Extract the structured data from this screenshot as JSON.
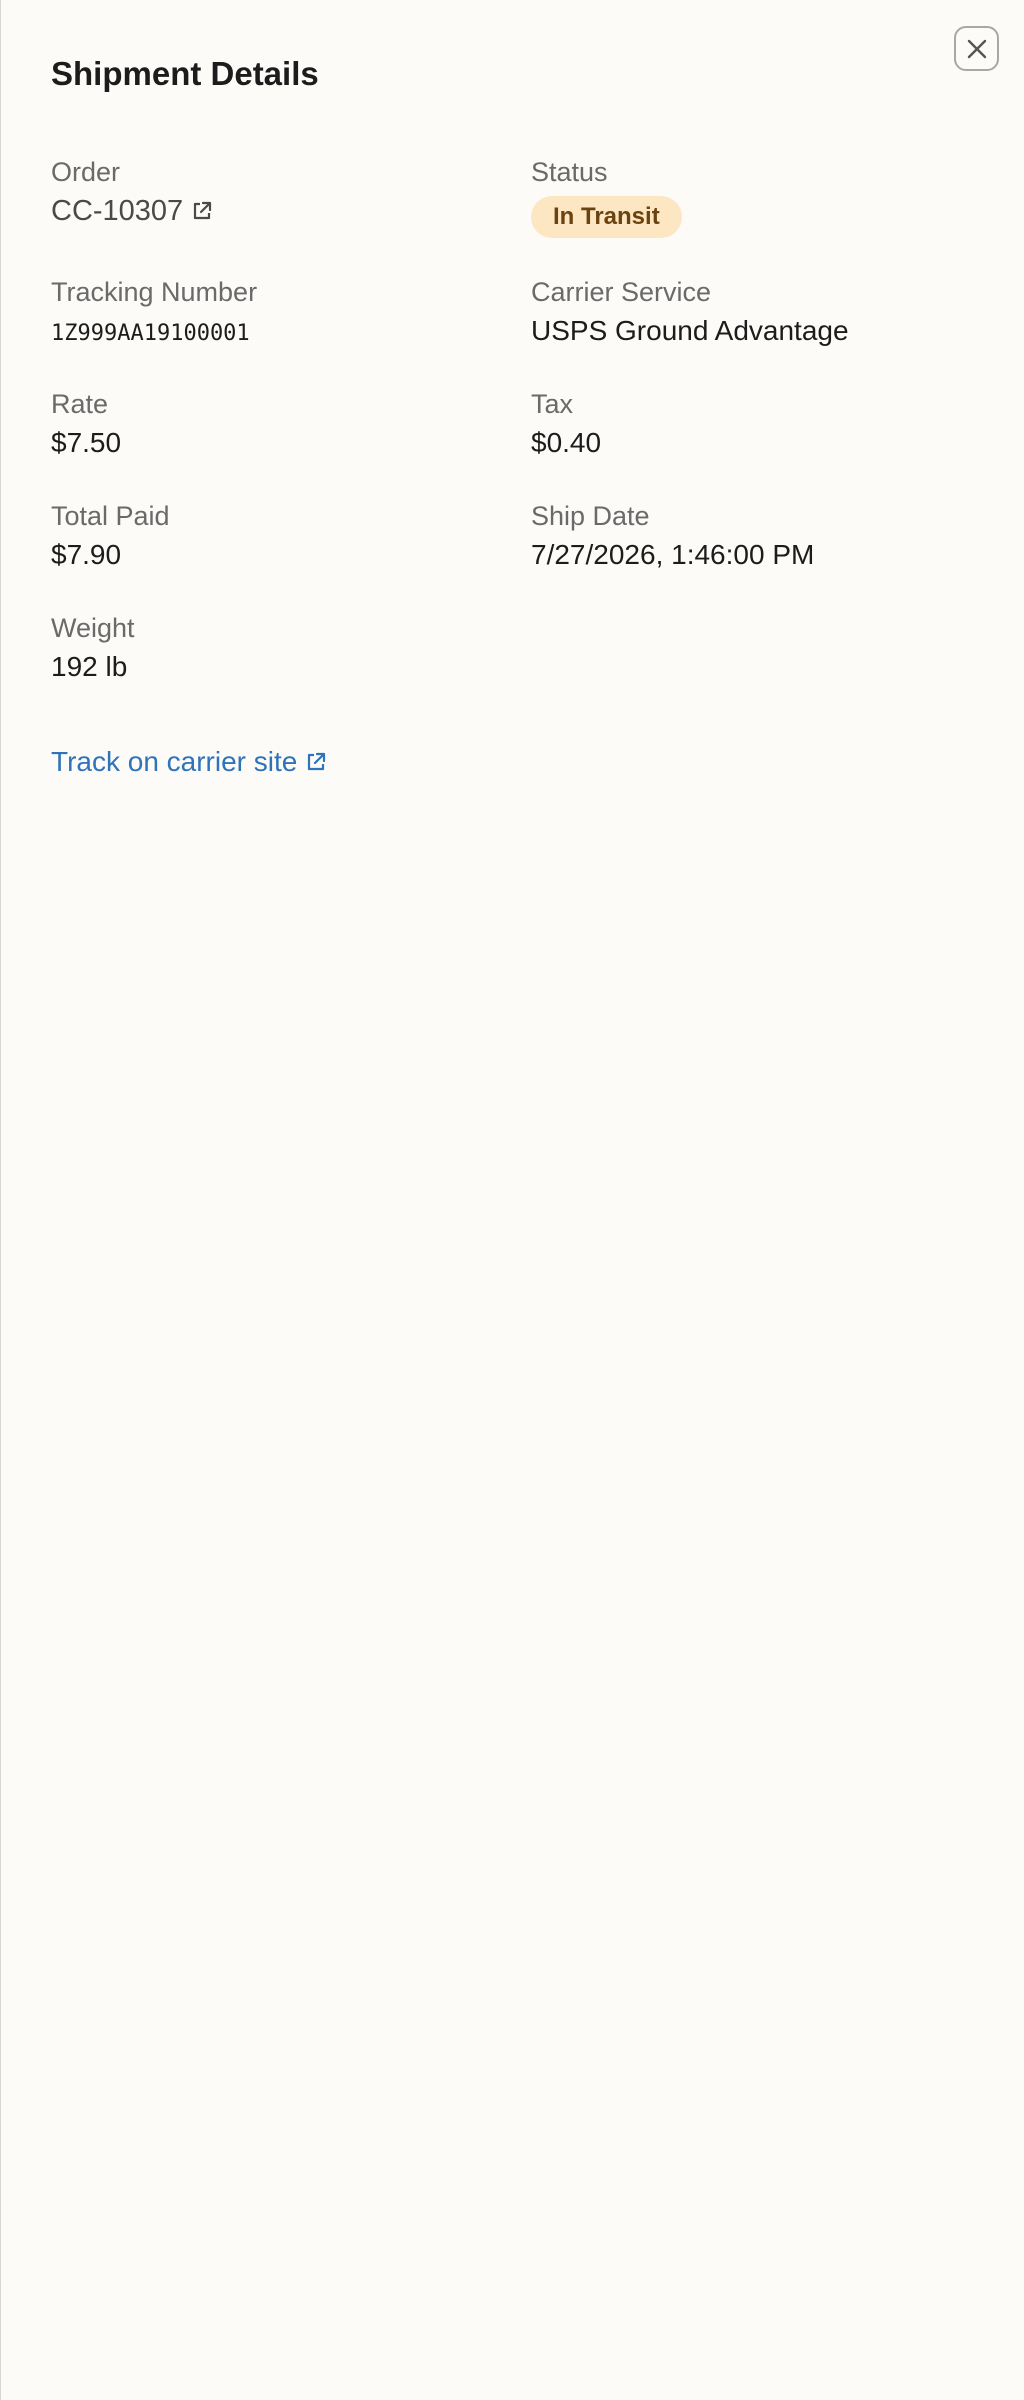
{
  "panel": {
    "title": "Shipment Details",
    "close_icon": "close-icon"
  },
  "fields": {
    "order": {
      "label": "Order",
      "value": "CC-10307",
      "icon": "external-link-icon"
    },
    "status": {
      "label": "Status",
      "value": "In Transit"
    },
    "tracking_number": {
      "label": "Tracking Number",
      "value": "1Z999AA19100001"
    },
    "carrier_service": {
      "label": "Carrier Service",
      "value": "USPS Ground Advantage"
    },
    "rate": {
      "label": "Rate",
      "value": "$7.50"
    },
    "tax": {
      "label": "Tax",
      "value": "$0.40"
    },
    "total_paid": {
      "label": "Total Paid",
      "value": "$7.90"
    },
    "ship_date": {
      "label": "Ship Date",
      "value": "7/27/2026, 1:46:00 PM"
    },
    "weight": {
      "label": "Weight",
      "value": "192 lb"
    }
  },
  "track_link": {
    "label": "Track on carrier site",
    "icon": "external-link-icon"
  },
  "colors": {
    "background": "#fcfbf8",
    "link": "#2f73b9",
    "status_badge_bg": "#fde6c2",
    "status_badge_text": "#6b4310"
  }
}
